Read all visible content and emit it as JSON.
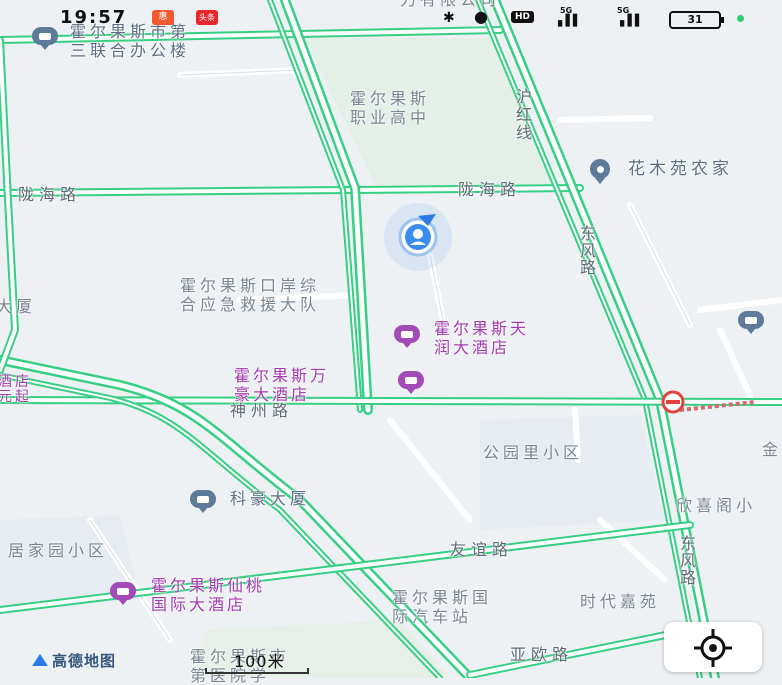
{
  "status_bar": {
    "time": "19:57",
    "app_badge_1": "惠",
    "app_badge_2": "头条",
    "bluetooth_icon": "bluetooth-icon",
    "location_icon": "location-pin-icon",
    "hd_badge": "HD",
    "network_1": "5G",
    "network_2": "5G",
    "battery": "31"
  },
  "map": {
    "labels": {
      "company_top": "力有限公司",
      "office_building": "霍尔果斯市第\n三联合办公楼",
      "vocational_school": "霍尔果斯\n职业高中",
      "huhong_line": "沪\n红\n线",
      "flower_farm": "花木苑农家",
      "longhai_left": "陇海路",
      "longhai_right": "陇海路",
      "dongfeng_top": "东\n风\n路",
      "port_rescue": "霍尔果斯口岸综\n合应急救援大队",
      "tianrun_hotel": "霍尔果斯天\n润大酒店",
      "wanhao_hotel": "霍尔果斯万\n豪大酒店",
      "shenzhou_road": "神州路",
      "park_community": "公园里小区",
      "kehao_building": "科豪大厦",
      "xinxige": "欣喜阁小",
      "jia_community": "居家园小区",
      "youyi_road": "友谊路",
      "dongfeng_bottom": "东\n风\n路",
      "xiantao_hotel": "霍尔果斯仙桃\n国际大酒店",
      "bus_station": "霍尔果斯国\n际汽车站",
      "shidai_jiayuan": "时代嘉苑",
      "yaou_road": "亚欧路",
      "city_bottom": "霍尔果斯市\n第医院学",
      "left_edge_dasha": "大厦",
      "left_edge_hotel": "酒店\n元起",
      "right_edge_jin": "金"
    }
  },
  "bottom_bar": {
    "logo": "高德地图",
    "scale_text": "100米",
    "locate_icon": "locate-crosshair-icon"
  },
  "colors": {
    "road_green": "#37cf84",
    "hotel_purple": "#a24bb6",
    "building_blue": "#5d7a99",
    "location_blue": "#2a7be6"
  }
}
